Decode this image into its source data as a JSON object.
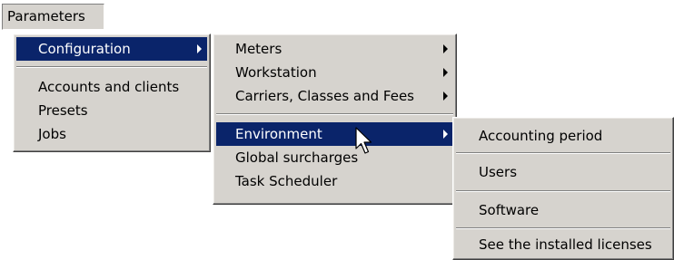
{
  "menubar": {
    "parameters_label": "Parameters"
  },
  "menus": {
    "parameters": {
      "configuration": "Configuration",
      "accounts_and_clients": "Accounts and clients",
      "presets": "Presets",
      "jobs": "Jobs"
    },
    "configuration": {
      "meters": "Meters",
      "workstation": "Workstation",
      "carriers_classes_fees": "Carriers, Classes and Fees",
      "environment": "Environment",
      "global_surcharges": "Global surcharges",
      "task_scheduler": "Task Scheduler"
    },
    "environment": {
      "accounting_period": "Accounting period",
      "users": "Users",
      "software": "Software",
      "installed_licenses": "See the installed licenses"
    }
  },
  "state": {
    "highlighted_path": [
      "Configuration",
      "Environment"
    ]
  },
  "colors": {
    "menu_background": "#d6d3ce",
    "selection_background": "#0a246a",
    "selection_text": "#ffffff"
  },
  "icons": {
    "submenu": "submenu-arrow-icon",
    "pointer": "mouse-pointer-icon"
  }
}
